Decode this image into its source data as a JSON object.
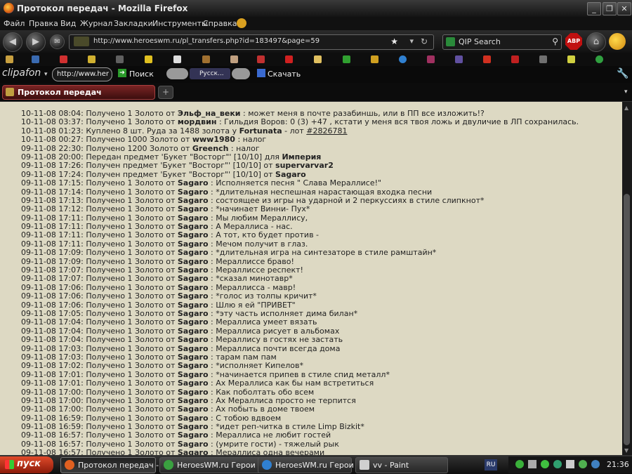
{
  "window": {
    "title": "Протокол передач - Mozilla Firefox"
  },
  "menu": [
    "Файл",
    "Правка",
    "Вид",
    "Журнал",
    "Закладки",
    "Инструменты",
    "Справка"
  ],
  "nav": {
    "url": "http://www.heroeswm.ru/pl_transfers.php?id=183497&page=59",
    "search_placeholder": "QIP Search",
    "abp": "ABP"
  },
  "clip": {
    "logo": "clipafon",
    "url_short": "http://www.her",
    "search_label": "Поиск",
    "lang": "Русск...",
    "download_label": "Скачать"
  },
  "tab": {
    "label": "Протокол передач"
  },
  "log": [
    {
      "t": "10-11-08 08:04: Получено 1 Золото от ",
      "u": "Эльф_на_веки",
      "m": " : может меня в почте разабиншь, или в ПП все изложить!?"
    },
    {
      "t": "10-11-08 03:37: Получено 1 Золото от ",
      "u": "мордвин",
      "m": " : Гильдия Воров: 0 (3) +47 , кстати у меня вся твоя ложь и двуличие в ЛП сохранилась."
    },
    {
      "t": "10-11-08 01:23: Куплено 8 шт. Руда за 1488 золота у ",
      "u": "Fortunata",
      "m": " - лот ",
      "lot": "#2826781"
    },
    {
      "t": "10-11-08 00:27: Получено 1000 Золото от ",
      "u": "www1980",
      "m": " : налог"
    },
    {
      "t": "09-11-08 22:30: Получено 1200 Золото от ",
      "u": "Greench",
      "m": " : налог"
    },
    {
      "t": "09-11-08 20:00: Передан предмет 'Букет \"Восторг\"' [10/10] для ",
      "u": "Империя",
      "m": ""
    },
    {
      "t": "09-11-08 17:26: Получен предмет 'Букет \"Восторг\"' [10/10] от ",
      "u": "supervarvar2",
      "m": ""
    },
    {
      "t": "09-11-08 17:24: Получен предмет 'Букет \"Восторг\"' [10/10] от ",
      "u": "Sagaro",
      "m": ""
    },
    {
      "t": "09-11-08 17:15: Получено 1 Золото от ",
      "u": "Sagaro",
      "m": " : Исполняется песня \" Слава Мераллисе!\""
    },
    {
      "t": "09-11-08 17:14: Получено 1 Золото от ",
      "u": "Sagaro",
      "m": " : *длительная неспешная нарастающая входка песни"
    },
    {
      "t": "09-11-08 17:13: Получено 1 Золото от ",
      "u": "Sagaro",
      "m": " : состоящее из игры на ударной и 2 перкуссиях в стиле слипкнот*"
    },
    {
      "t": "09-11-08 17:12: Получено 1 Золото от ",
      "u": "Sagaro",
      "m": " : *начинает Винни- Пух*"
    },
    {
      "t": "09-11-08 17:11: Получено 1 Золото от ",
      "u": "Sagaro",
      "m": " : Мы любим Мераллису,"
    },
    {
      "t": "09-11-08 17:11: Получено 1 Золото от ",
      "u": "Sagaro",
      "m": " : А Мераллиса - нас."
    },
    {
      "t": "09-11-08 17:11: Получено 1 Золото от ",
      "u": "Sagaro",
      "m": " : А тот, кто будет против -"
    },
    {
      "t": "09-11-08 17:11: Получено 1 Золото от ",
      "u": "Sagaro",
      "m": " : Мечом получит в глаз."
    },
    {
      "t": "09-11-08 17:09: Получено 1 Золото от ",
      "u": "Sagaro",
      "m": " : *длительная игра на синтезаторе в стиле рамштайн*"
    },
    {
      "t": "09-11-08 17:09: Получено 1 Золото от ",
      "u": "Sagaro",
      "m": " : Мераллиссе браво!"
    },
    {
      "t": "09-11-08 17:07: Получено 1 Золото от ",
      "u": "Sagaro",
      "m": " : Мераллиссе респект!"
    },
    {
      "t": "09-11-08 17:07: Получено 1 Золото от ",
      "u": "Sagaro",
      "m": " : *сказал минотавр*"
    },
    {
      "t": "09-11-08 17:06: Получено 1 Золото от ",
      "u": "Sagaro",
      "m": " : Мераллисса - мавр!"
    },
    {
      "t": "09-11-08 17:06: Получено 1 Золото от ",
      "u": "Sagaro",
      "m": " : *голос из толпы кричит*"
    },
    {
      "t": "09-11-08 17:06: Получено 1 Золото от ",
      "u": "Sagaro",
      "m": " : Шлю я ей \"ПРИВЕТ\""
    },
    {
      "t": "09-11-08 17:05: Получено 1 Золото от ",
      "u": "Sagaro",
      "m": " : *эту часть исполняет дима билан*"
    },
    {
      "t": "09-11-08 17:04: Получено 1 Золото от ",
      "u": "Sagaro",
      "m": " : Мераллиса умеет вязать"
    },
    {
      "t": "09-11-08 17:04: Получено 1 Золото от ",
      "u": "Sagaro",
      "m": " : Мераллиса рисует в альбомах"
    },
    {
      "t": "09-11-08 17:04: Получено 1 Золото от ",
      "u": "Sagaro",
      "m": " : Мераллису в гостях не застать"
    },
    {
      "t": "09-11-08 17:03: Получено 1 Золото от ",
      "u": "Sagaro",
      "m": " : Мераллиса почти всегда дома"
    },
    {
      "t": "09-11-08 17:03: Получено 1 Золото от ",
      "u": "Sagaro",
      "m": " : тарам пам пам"
    },
    {
      "t": "09-11-08 17:02: Получено 1 Золото от ",
      "u": "Sagaro",
      "m": " : *исполняет Кипелов*"
    },
    {
      "t": "09-11-08 17:01: Получено 1 Золото от ",
      "u": "Sagaro",
      "m": " : *начинается припев в стиле спид металл*"
    },
    {
      "t": "09-11-08 17:01: Получено 1 Золото от ",
      "u": "Sagaro",
      "m": " : Ах Мераллиса как бы нам встретиться"
    },
    {
      "t": "09-11-08 17:00: Получено 1 Золото от ",
      "u": "Sagaro",
      "m": " : Как поболтать обо всем"
    },
    {
      "t": "09-11-08 17:00: Получено 1 Золото от ",
      "u": "Sagaro",
      "m": " : Ах Мераллиса просто не терпится"
    },
    {
      "t": "09-11-08 17:00: Получено 1 Золото от ",
      "u": "Sagaro",
      "m": " : Ах побыть в доме твоем"
    },
    {
      "t": "09-11-08 16:59: Получено 1 Золото от ",
      "u": "Sagaro",
      "m": " : С тобою вдвоем"
    },
    {
      "t": "09-11-08 16:59: Получено 1 Золото от ",
      "u": "Sagaro",
      "m": " : *идет реп-читка в стиле Limp Bizkit*"
    },
    {
      "t": "09-11-08 16:57: Получено 1 Золото от ",
      "u": "Sagaro",
      "m": " : Мераллиса не любит гостей"
    },
    {
      "t": "09-11-08 16:57: Получено 1 Золото от ",
      "u": "Sagaro",
      "m": " : (умрите гости) - тяжелый рык"
    },
    {
      "t": "09-11-08 16:57: Получено 1 Золото от ",
      "u": "Sagaro",
      "m": " : Мераллиса одна вечерами"
    }
  ],
  "taskbar": {
    "start": "пуск",
    "items": [
      {
        "label": "Протокол передач -..."
      },
      {
        "label": "HeroesWM.ru Герои ..."
      },
      {
        "label": "HeroesWM.ru Герои ..."
      },
      {
        "label": "vv - Paint"
      }
    ],
    "lang": "RU",
    "clock": "21:36"
  }
}
